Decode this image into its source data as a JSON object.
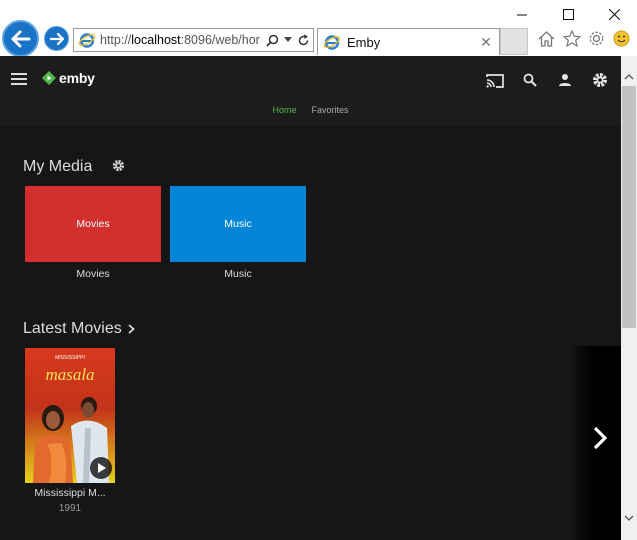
{
  "browser": {
    "url_prefix": "http://",
    "url_host": "localhost",
    "url_rest": ":8096/web/hor",
    "tab_title": "Emby"
  },
  "app": {
    "logo_text": "emby",
    "tabs": [
      {
        "label": "Home"
      },
      {
        "label": "Favorites"
      }
    ],
    "my_media": {
      "title": "My Media",
      "tiles": [
        {
          "label": "Movies",
          "caption": "Movies",
          "color": "#d32f2f"
        },
        {
          "label": "Music",
          "caption": "Music",
          "color": "#0386d8"
        }
      ]
    },
    "latest_movies": {
      "title": "Latest Movies",
      "items": [
        {
          "title": "Mississippi M...",
          "year": "1991",
          "poster_text": "masala",
          "poster_banner": "MISSISSIPPI"
        }
      ]
    }
  },
  "colors": {
    "accent": "#52b54b",
    "background": "#161616",
    "header": "#1c1c1c"
  }
}
